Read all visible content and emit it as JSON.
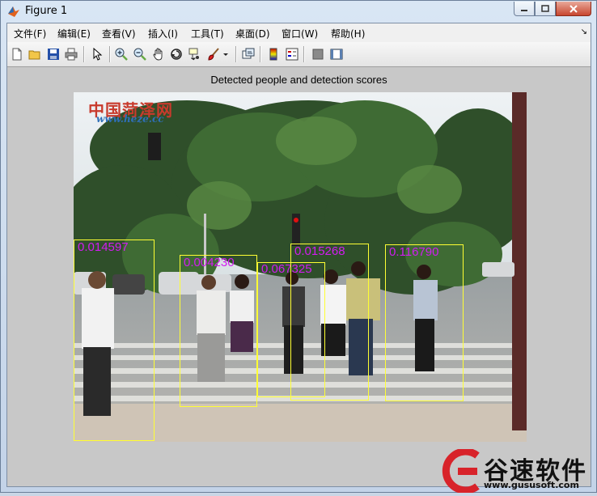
{
  "window": {
    "title": "Figure 1"
  },
  "menu": [
    {
      "label": "文件(F)"
    },
    {
      "label": "编辑(E)"
    },
    {
      "label": "查看(V)"
    },
    {
      "label": "插入(I)"
    },
    {
      "label": "工具(T)"
    },
    {
      "label": "桌面(D)"
    },
    {
      "label": "窗口(W)"
    },
    {
      "label": "帮助(H)"
    }
  ],
  "toolbar_icons": [
    "new-figure-icon",
    "open-file-icon",
    "save-icon",
    "print-icon",
    "edit-plot-arrow-icon",
    "zoom-in-icon",
    "zoom-out-icon",
    "pan-hand-icon",
    "rotate-3d-icon",
    "data-cursor-icon",
    "brush-icon",
    "brush-dropdown-icon",
    "link-plot-icon",
    "colorbar-icon",
    "legend-icon",
    "hide-plot-tools-icon",
    "show-plot-tools-icon"
  ],
  "figure": {
    "title": "Detected people and detection scores",
    "watermark": {
      "site": "中国菏泽网",
      "url": "www.heze.cc"
    },
    "detections": [
      {
        "score": "0.014597"
      },
      {
        "score": "0.004230"
      },
      {
        "score": "0.067325"
      },
      {
        "score": "0.015268"
      },
      {
        "score": "0.116790"
      }
    ]
  },
  "brand": {
    "name": "谷速软件",
    "url": "www.gususoft.com"
  },
  "colors": {
    "bbox": "#ffff33",
    "score_text": "#d21cf0",
    "figure_bg": "#c8c8c8",
    "brand_red": "#d8232a"
  }
}
